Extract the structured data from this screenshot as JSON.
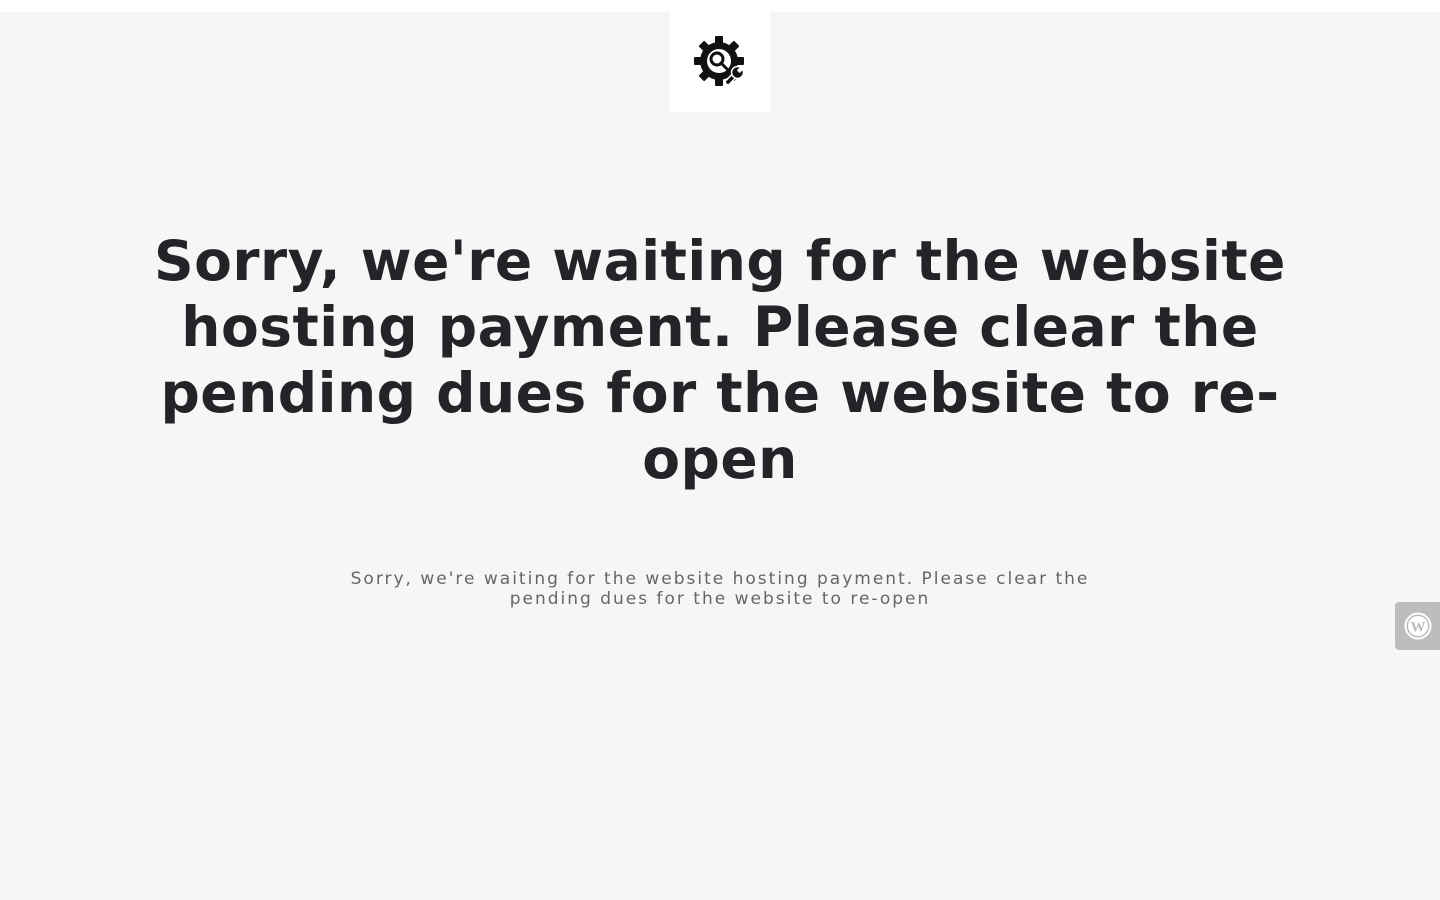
{
  "page": {
    "background_color": "#f6f6f6",
    "logo_icon": "gear-wrench-icon",
    "headline": "Sorry, we're waiting for the website hosting payment. Please clear the pending dues for the website to re-open",
    "subtext": "Sorry, we're waiting for the website hosting payment. Please clear the pending dues for the website to re-open",
    "headline_color": "#222427",
    "subtext_color": "#666666"
  },
  "login_tab": {
    "icon": "wordpress-icon",
    "color": "#bdbdbd"
  }
}
